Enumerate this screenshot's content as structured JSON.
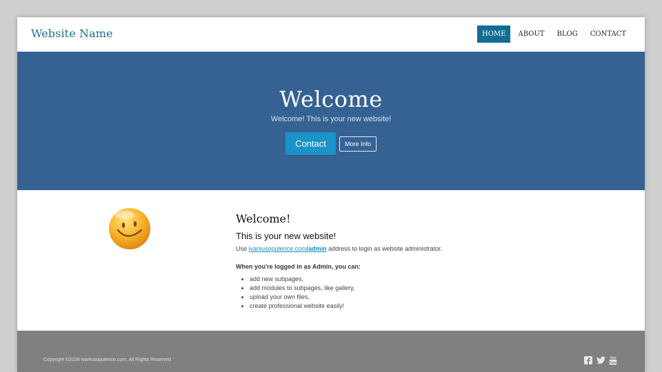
{
  "header": {
    "brand": "Website Name",
    "nav": [
      {
        "label": "HOME",
        "active": true
      },
      {
        "label": "ABOUT",
        "active": false
      },
      {
        "label": "BLOG",
        "active": false
      },
      {
        "label": "CONTACT",
        "active": false
      }
    ]
  },
  "hero": {
    "title": "Welcome",
    "subtitle": "Welcome! This is your new website!",
    "contact_button": "Contact",
    "more_button": "More Info",
    "background": "#356293"
  },
  "main": {
    "image_icon": "smiley-face-icon",
    "heading": "Welcome!",
    "subheading": "This is your new website!",
    "login_prefix": "Use ",
    "login_link_domain": "ivaniusopulence.com",
    "login_link_path": "/admin",
    "login_suffix": " address to login as website administrator.",
    "lead": "When you're logged in as Admin, you can:",
    "list": [
      "add new subpages,",
      "add modules to subpages, like gallery,",
      "upload your own files,",
      "create professional website easily!"
    ]
  },
  "footer": {
    "copyright": "Copyright ©2026 ivaniusopulence.com, All Rights Reserved",
    "social_icons": [
      "facebook-icon",
      "twitter-icon",
      "youtube-icon"
    ]
  },
  "colors": {
    "accent": "#116d94",
    "brand_text": "#1f6f92",
    "button": "#1993c8",
    "footer": "#808080"
  }
}
